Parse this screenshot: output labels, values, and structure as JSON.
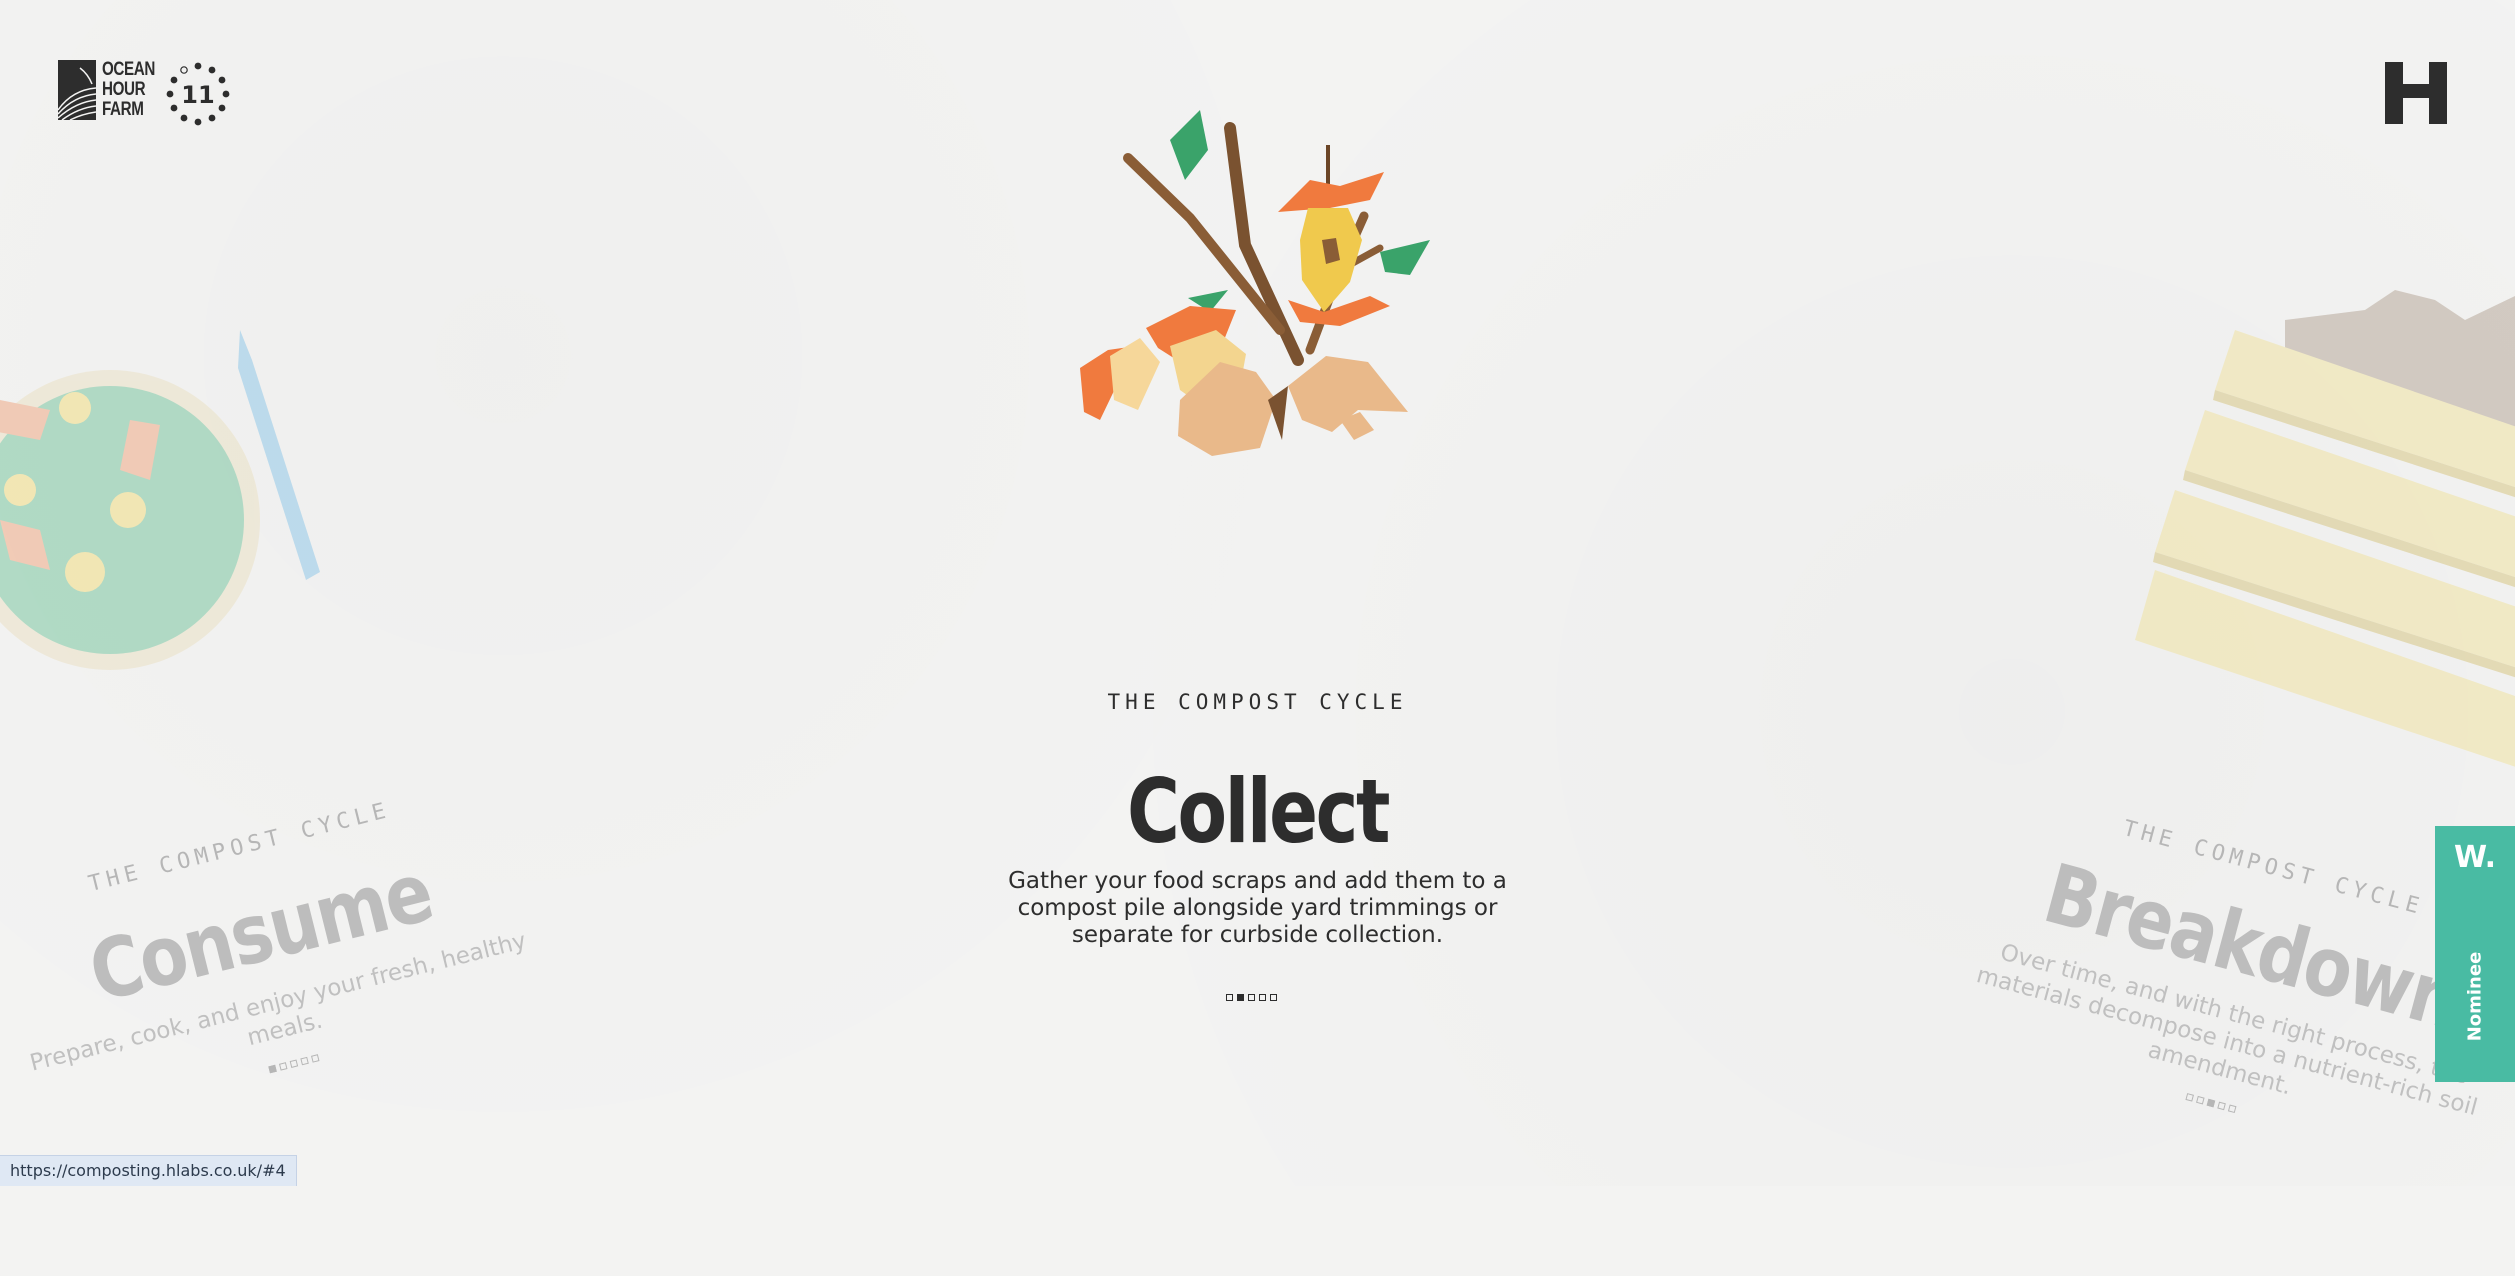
{
  "brand": {
    "ocean_hour_farm_lines": [
      "OCEAN",
      "HOUR",
      "FARM"
    ],
    "badge_number": "11",
    "h_logo_letter": "H"
  },
  "slide": {
    "kicker": "THE COMPOST CYCLE",
    "title": "Collect",
    "description": "Gather your food scraps and add them to a compost pile alongside yard trimmings or separate for curbside collection.",
    "pager_count": 5,
    "pager_active_index": 1
  },
  "prev_slide": {
    "kicker": "THE COMPOST CYCLE",
    "title": "Consume",
    "description": "Prepare, cook, and enjoy your fresh, healthy meals."
  },
  "next_slide": {
    "kicker": "THE COMPOST CYCLE",
    "title": "Breakdown",
    "description": "Over time, and with the right process, the materials decompose into a nutrient-rich soil amendment."
  },
  "ribbon": {
    "logo": "W.",
    "label": "Nominee",
    "color": "#49bba3"
  },
  "status_bar": {
    "url": "https://composting.hlabs.co.uk/#4"
  },
  "icons": [
    "ocean-hour-farm-logo",
    "eleven-badge-icon",
    "h-logo-icon",
    "compost-scraps-illustration",
    "salad-bowl-illustration",
    "knife-illustration",
    "crate-illustration"
  ]
}
